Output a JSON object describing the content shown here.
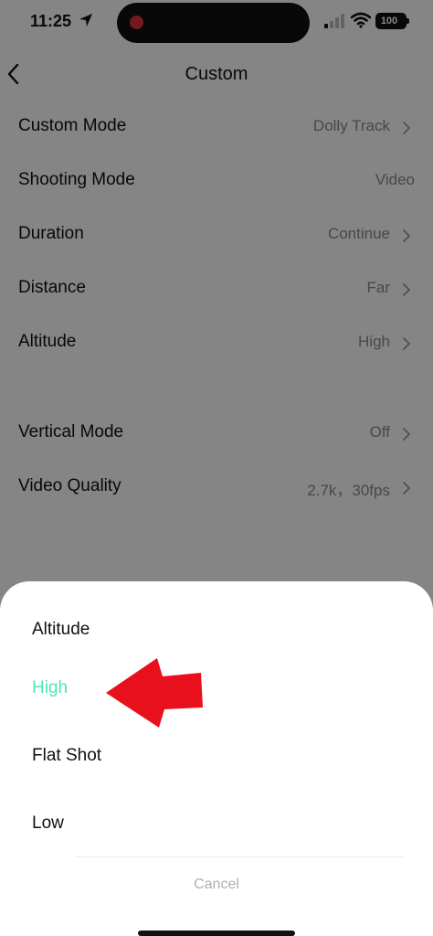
{
  "status_bar": {
    "time": "11:25",
    "battery": "100"
  },
  "nav": {
    "title": "Custom"
  },
  "settings": [
    {
      "label": "Custom Mode",
      "value": "Dolly Track"
    },
    {
      "label": "Shooting Mode",
      "value": "Video"
    },
    {
      "label": "Duration",
      "value": "Continue"
    },
    {
      "label": "Distance",
      "value": "Far"
    },
    {
      "label": "Altitude",
      "value": "High"
    },
    {
      "label": "Vertical Mode",
      "value": "Off"
    },
    {
      "label": "Video Quality",
      "value": "2.7k，30fps"
    }
  ],
  "sheet": {
    "title": "Altitude",
    "options": [
      {
        "label": "High",
        "selected": true
      },
      {
        "label": "Flat Shot",
        "selected": false
      },
      {
        "label": "Low",
        "selected": false
      }
    ],
    "cancel": "Cancel"
  },
  "colors": {
    "accent": "#52e5b2",
    "annotation_arrow": "#e8101c",
    "recording_dot": "#e0313a"
  }
}
